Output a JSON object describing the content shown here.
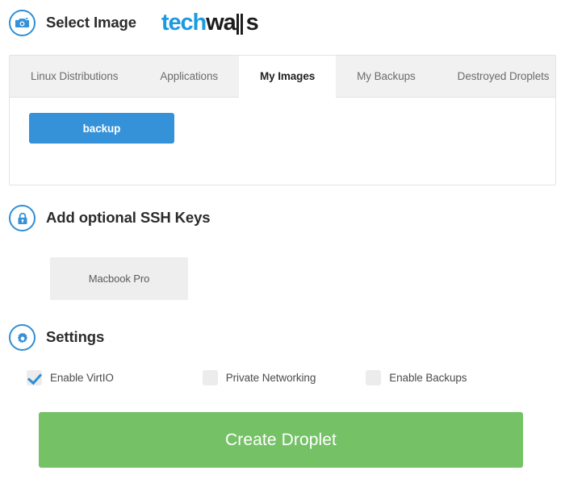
{
  "header": {
    "icon": "camera-icon",
    "title": "Select Image",
    "logo": {
      "part_blue": "tech",
      "part_dark": "wa",
      "part_tail": "s",
      "full_text": "techwalls",
      "color_blue": "#1b9ae0",
      "color_dark": "#1d1d1d"
    }
  },
  "image_tabs": {
    "tabs": [
      {
        "label": "Linux Distributions",
        "active": false
      },
      {
        "label": "Applications",
        "active": false
      },
      {
        "label": "My Images",
        "active": true
      },
      {
        "label": "My Backups",
        "active": false
      },
      {
        "label": "Destroyed Droplets",
        "active": false
      }
    ],
    "panel": {
      "items": [
        {
          "label": "backup",
          "selected": true,
          "color": "#3591d8"
        }
      ]
    }
  },
  "ssh": {
    "icon": "lock-icon",
    "title": "Add optional SSH Keys",
    "keys": [
      {
        "label": "Macbook Pro",
        "selected": false
      }
    ]
  },
  "settings": {
    "icon": "gear-icon",
    "title": "Settings",
    "options": [
      {
        "label": "Enable VirtIO",
        "checked": true
      },
      {
        "label": "Private Networking",
        "checked": false
      },
      {
        "label": "Enable Backups",
        "checked": false
      }
    ]
  },
  "actions": {
    "create_label": "Create Droplet",
    "create_color": "#74c166"
  }
}
